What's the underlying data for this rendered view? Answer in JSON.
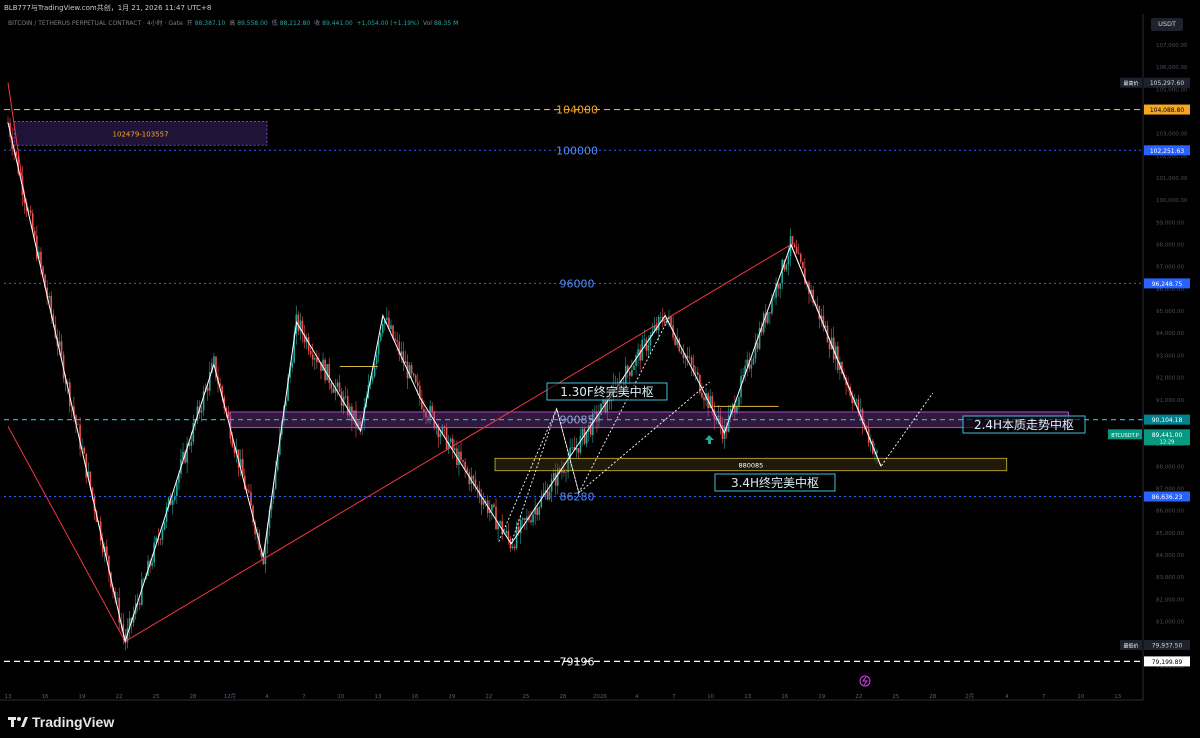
{
  "header": {
    "window_title": "BLB777与TradingView.com共创，1月 21, 2026 11:47 UTC+8",
    "symbol_line": "BITCOIN / TETHERUS PERPETUAL CONTRACT · 4小时 · Gate",
    "ohlc": {
      "open_label": "开",
      "open": "88,387.10",
      "high_label": "高",
      "high": "89,558.00",
      "low_label": "低",
      "low": "88,212.80",
      "close_label": "收",
      "close": "89,441.00",
      "change": "+1,054.00 (+1.19%)",
      "volume_label": "Vol",
      "volume": "88.35 M"
    },
    "currency_button": "USDT"
  },
  "branding": {
    "logo_text": "TradingView"
  },
  "colors": {
    "background": "#000000",
    "candle_up": "#26a69a",
    "candle_down": "#ef5350",
    "trend_red": "#f23645",
    "level_orange": "#f5a623",
    "level_blue": "#2962ff",
    "level_cyan": "#00bcd4",
    "zone_purple": "#8e44ad",
    "text_cyan": "#3fc1d9",
    "white": "#ffffff"
  },
  "chart_data": {
    "type": "candlestick",
    "ylim": [
      78000,
      108000
    ],
    "y_ticks": [
      79000,
      80000,
      81000,
      82000,
      83000,
      84000,
      85000,
      86000,
      87000,
      88000,
      89000,
      90000,
      91000,
      92000,
      93000,
      94000,
      95000,
      96000,
      97000,
      98000,
      99000,
      100000,
      101000,
      102000,
      103000,
      104000,
      105000,
      106000,
      107000
    ],
    "x_ticks": [
      "13",
      "16",
      "19",
      "22",
      "25",
      "28",
      "12月",
      "4",
      "7",
      "10",
      "13",
      "16",
      "19",
      "22",
      "25",
      "28",
      "2026",
      "4",
      "7",
      "10",
      "13",
      "16",
      "19",
      "22",
      "25",
      "28",
      "2月",
      "4",
      "7",
      "10",
      "13"
    ],
    "x_range_days": [
      0,
      93
    ],
    "price_labels": [
      {
        "text": "最高价",
        "value": "105,297.60",
        "y": 105297.6,
        "style": "dark"
      },
      {
        "text": "",
        "value": "104,088.80",
        "y": 104088.8,
        "style": "orange"
      },
      {
        "text": "",
        "value": "102,251.63",
        "y": 102251.63,
        "style": "blue"
      },
      {
        "text": "",
        "value": "96,248.75",
        "y": 96248.75,
        "style": "blue"
      },
      {
        "text": "",
        "value": "90,104.18",
        "y": 90104.18,
        "style": "cyan"
      },
      {
        "text": "BTCUSDT.P",
        "value": "89,441.00",
        "sub": "12:29",
        "y": 89441,
        "style": "green"
      },
      {
        "text": "",
        "value": "86,636.23",
        "y": 86636.23,
        "style": "blue"
      },
      {
        "text": "最低价",
        "value": "79,937.50",
        "y": 79937.5,
        "style": "dark"
      },
      {
        "text": "",
        "value": "79,199.89",
        "y": 79199.89,
        "style": "white"
      }
    ],
    "horizontal_levels": [
      {
        "label": "104000",
        "y": 104088.8,
        "color": "#f5a623",
        "dash": "6,4",
        "width": 1.2
      },
      {
        "label": "100000",
        "y": 102251.63,
        "color": "#2962ff",
        "dash": "2,3",
        "width": 1
      },
      {
        "label": "96000",
        "y": 96248.75,
        "color": "#2962ff",
        "dash": "2,3",
        "width": 1
      },
      {
        "label": "90085",
        "y": 90104.18,
        "color": "#00bcd4",
        "dash": "5,4",
        "width": 1.2
      },
      {
        "label": "86280",
        "y": 86636.23,
        "color": "#2962ff",
        "dash": "2,3",
        "width": 1
      },
      {
        "label": "79196",
        "y": 79199.89,
        "color": "#ffffff",
        "dash": "6,4",
        "width": 1.2
      }
    ],
    "annotations": {
      "zone_top": "102479-103557",
      "box1": "1.30F终完美中枢",
      "box2": "2.4H本质走势中枢",
      "box3": "3.4H终完美中枢",
      "zone_mid": "880085"
    },
    "zones": [
      {
        "day0": 0.5,
        "day1": 21,
        "top": 103557,
        "bottom": 102479,
        "label_key": "zone_top"
      },
      {
        "day0": 18,
        "day1": 86,
        "top": 90450,
        "bottom": 89740
      },
      {
        "day0": 39.5,
        "day1": 81,
        "top": 88360,
        "bottom": 87800,
        "label_key": "zone_mid"
      }
    ],
    "wave_white": [
      [
        0,
        103500
      ],
      [
        9.5,
        80100
      ],
      [
        16.7,
        92600
      ],
      [
        20.7,
        83900
      ],
      [
        23.4,
        94500
      ],
      [
        28.6,
        89600
      ],
      [
        30.4,
        94800
      ],
      [
        33.4,
        91100
      ],
      [
        40.8,
        84500
      ],
      [
        53.3,
        94800
      ],
      [
        58.1,
        89500
      ],
      [
        63.5,
        98000
      ],
      [
        70.8,
        88000
      ],
      [
        75,
        91300
      ]
    ],
    "wave_dotted": [
      [
        39.8,
        84600
      ],
      [
        44.5,
        90600
      ],
      [
        46.3,
        86800
      ],
      [
        53.6,
        94700
      ],
      [
        40.8,
        84500
      ],
      [
        44.5,
        90600
      ],
      [
        46.3,
        86800
      ],
      [
        56.9,
        91800
      ]
    ],
    "trend_red": [
      [
        0,
        89800
      ],
      [
        9.5,
        80100
      ],
      [
        63.5,
        98000
      ],
      [
        70.8,
        88000
      ]
    ],
    "red_top_wick": [
      [
        0,
        105300
      ],
      [
        1.4,
        100000
      ]
    ]
  }
}
